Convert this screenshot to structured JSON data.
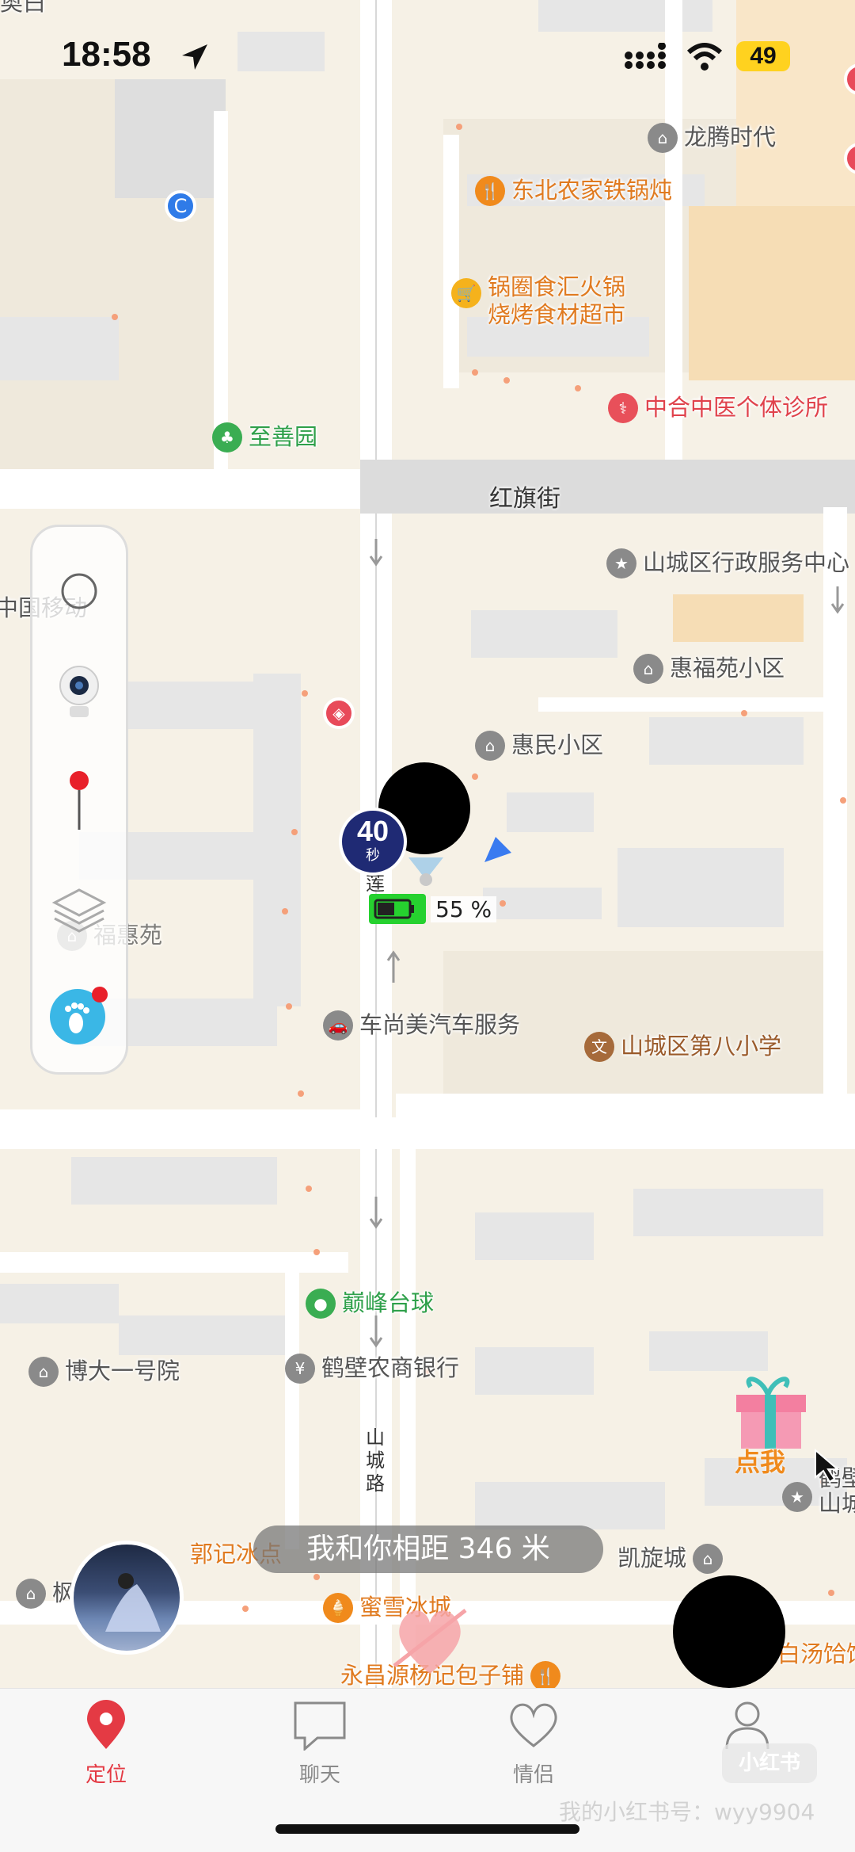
{
  "status_bar": {
    "time": "18:58",
    "battery": "49"
  },
  "map": {
    "roads": {
      "hongqi": "红旗街",
      "vertical_1": "莲",
      "vertical_2": "山城路"
    },
    "pois": [
      {
        "name": "龙腾时代",
        "style": "gray",
        "icon": "residential-icon"
      },
      {
        "name": "东北农家铁锅炖",
        "style": "orange",
        "icon": "restaurant-icon"
      },
      {
        "name": "锅圈食汇火锅\n烧烤食材超市",
        "style": "orange",
        "icon": "shopping-cart-icon"
      },
      {
        "name": "中合中医个体诊所",
        "style": "red",
        "icon": "clinic-icon"
      },
      {
        "name": "至善园",
        "style": "green",
        "icon": "park-icon"
      },
      {
        "name": "山城区行政服务中心",
        "style": "gray",
        "icon": "government-icon"
      },
      {
        "name": "惠福苑小区",
        "style": "gray",
        "icon": "residential-icon"
      },
      {
        "name": "惠民小区",
        "style": "gray",
        "icon": "residential-icon"
      },
      {
        "name": "中国移动",
        "style": "gray",
        "icon": ""
      },
      {
        "name": "福惠苑",
        "style": "gray",
        "icon": "residential-icon"
      },
      {
        "name": "车尚美汽车服务",
        "style": "gray",
        "icon": "car-icon"
      },
      {
        "name": "山城区第八小学",
        "style": "brown",
        "icon": "school-icon"
      },
      {
        "name": "巅峰台球",
        "style": "green",
        "icon": "billiards-icon"
      },
      {
        "name": "博大一号院",
        "style": "gray",
        "icon": "residential-icon"
      },
      {
        "name": "鹤壁农商银行",
        "style": "gray",
        "icon": "bank-icon"
      },
      {
        "name": "凯旋城",
        "style": "gray",
        "icon": "residential-icon"
      },
      {
        "name": "郭记冰点",
        "style": "orange",
        "icon": ""
      },
      {
        "name": "蜜雪冰城",
        "style": "orange",
        "icon": "icecream-icon"
      },
      {
        "name": "永昌源杨记包子铺",
        "style": "orange",
        "icon": "restaurant-icon"
      },
      {
        "name": "白汤饸饹",
        "style": "orange",
        "icon": ""
      },
      {
        "name": "枫",
        "style": "gray",
        "icon": "residential-icon"
      },
      {
        "name": "鹤壁\n山城",
        "style": "gray",
        "icon": "government-icon"
      },
      {
        "name": "奥白",
        "style": "gray",
        "icon": ""
      }
    ]
  },
  "marker": {
    "timer_value": "40",
    "timer_unit": "秒",
    "battery_percent": "55 %",
    "battery_level": 0.55
  },
  "distance_text": "我和你相距 346 米",
  "gift_label": "点我",
  "tabs": [
    {
      "label": "定位",
      "icon": "location-pin-icon",
      "active": true
    },
    {
      "label": "聊天",
      "icon": "chat-bubble-icon",
      "active": false
    },
    {
      "label": "情侣",
      "icon": "heart-icon",
      "active": false
    },
    {
      "label": "",
      "icon": "profile-icon",
      "active": false
    }
  ],
  "watermark": "我的小红书号：wyy9904",
  "xhs_badge": "小红书",
  "colors": {
    "accent": "#e43a44",
    "timer_bg": "#1f2a74",
    "battery_green": "#26d12f"
  }
}
